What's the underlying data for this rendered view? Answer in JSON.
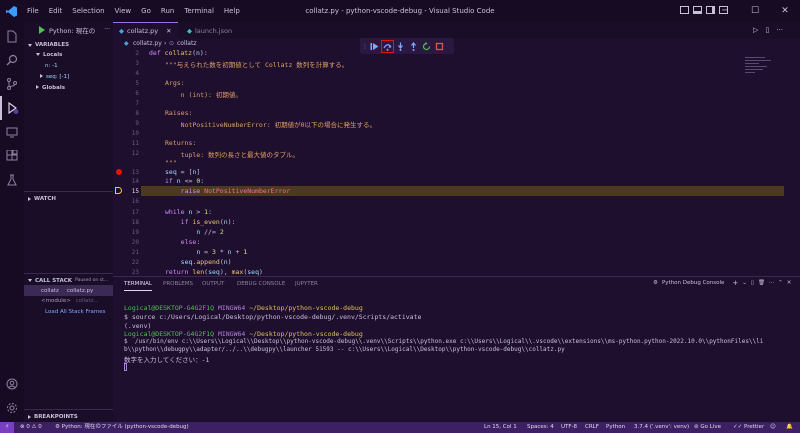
{
  "titlebar": {
    "menu": [
      "File",
      "Edit",
      "Selection",
      "View",
      "Go",
      "Run",
      "Terminal",
      "Help"
    ],
    "title": "collatz.py - python-vscode-debug - Visual Studio Code"
  },
  "sidebar": {
    "run_config": "Python: 現在の",
    "variables_header": "VARIABLES",
    "locals_label": "Locals",
    "var_n": "n: -1",
    "var_seq": "seq: [-1]",
    "globals_label": "Globals",
    "watch_header": "WATCH",
    "callstack_header": "CALL STACK",
    "callstack_status": "Paused on st...",
    "frame1_name": "collatz",
    "frame1_file": "collatz.py",
    "frame2_name": "<module>",
    "frame2_file": "collatz...",
    "load_all": "Load All Stack Frames",
    "breakpoints_header": "BREAKPOINTS"
  },
  "tabs": [
    {
      "label": "collatz.py",
      "active": true
    },
    {
      "label": "launch.json",
      "active": false
    }
  ],
  "breadcrumb": {
    "file": "collatz.py",
    "symbol": "collatz"
  },
  "editor": {
    "current_line": 15,
    "breakpoint_line": 13
  },
  "panel": {
    "tabs": [
      "TERMINAL",
      "PROBLEMS",
      "OUTPUT",
      "DEBUG CONSOLE",
      "JUPYTER"
    ],
    "terminal_select": "Python Debug Console",
    "prompt1_user": "Logical@DESKTOP-G4G2F1Q",
    "prompt1_shell": "MINGW64",
    "prompt1_path": "~/Desktop/python-vscode-debug",
    "cmd1": "$ source c:/Users/Logical/Desktop/python-vscode-debug/.venv/Scripts/activate",
    "venv": "(.venv)",
    "prompt2_user": "Logical@DESKTOP-G4G2F1Q",
    "prompt2_shell": "MINGW64",
    "prompt2_path": "~/Desktop/python-vscode-debug",
    "cmd2a": "$  /usr/bin/env c:\\\\Users\\\\Logical\\\\Desktop\\\\python-vscode-debug\\\\.venv\\\\Scripts\\\\python.exe c:\\\\Users\\\\Logical\\\\.vscode\\\\extensions\\\\ms-python.python-2022.10.0\\\\pythonFiles\\\\li",
    "cmd2b": "b\\\\python\\\\debugpy\\\\adapter/../..\\\\debugpy\\\\launcher 51593 -- c:\\\\Users\\\\Logical\\\\Desktop\\\\python-vscode-debug\\\\collatz.py",
    "input_line": "数字を入力してください：-1"
  },
  "statusbar": {
    "errors": "0",
    "warnings": "0",
    "run": "Python: 現在のファイル (python-vscode-debug)",
    "position": "Ln 15, Col 1",
    "spaces": "Spaces: 4",
    "encoding": "UTF-8",
    "eol": "CRLF",
    "language": "Python",
    "interpreter": "3.7.4 ('.venv': venv)",
    "golive": "Go Live",
    "prettier": "Prettier"
  },
  "colors": {
    "background": "#1e0f2e",
    "accent": "#3d1f63",
    "highlight_line": "#4b3a1e",
    "breakpoint": "#e51400"
  }
}
